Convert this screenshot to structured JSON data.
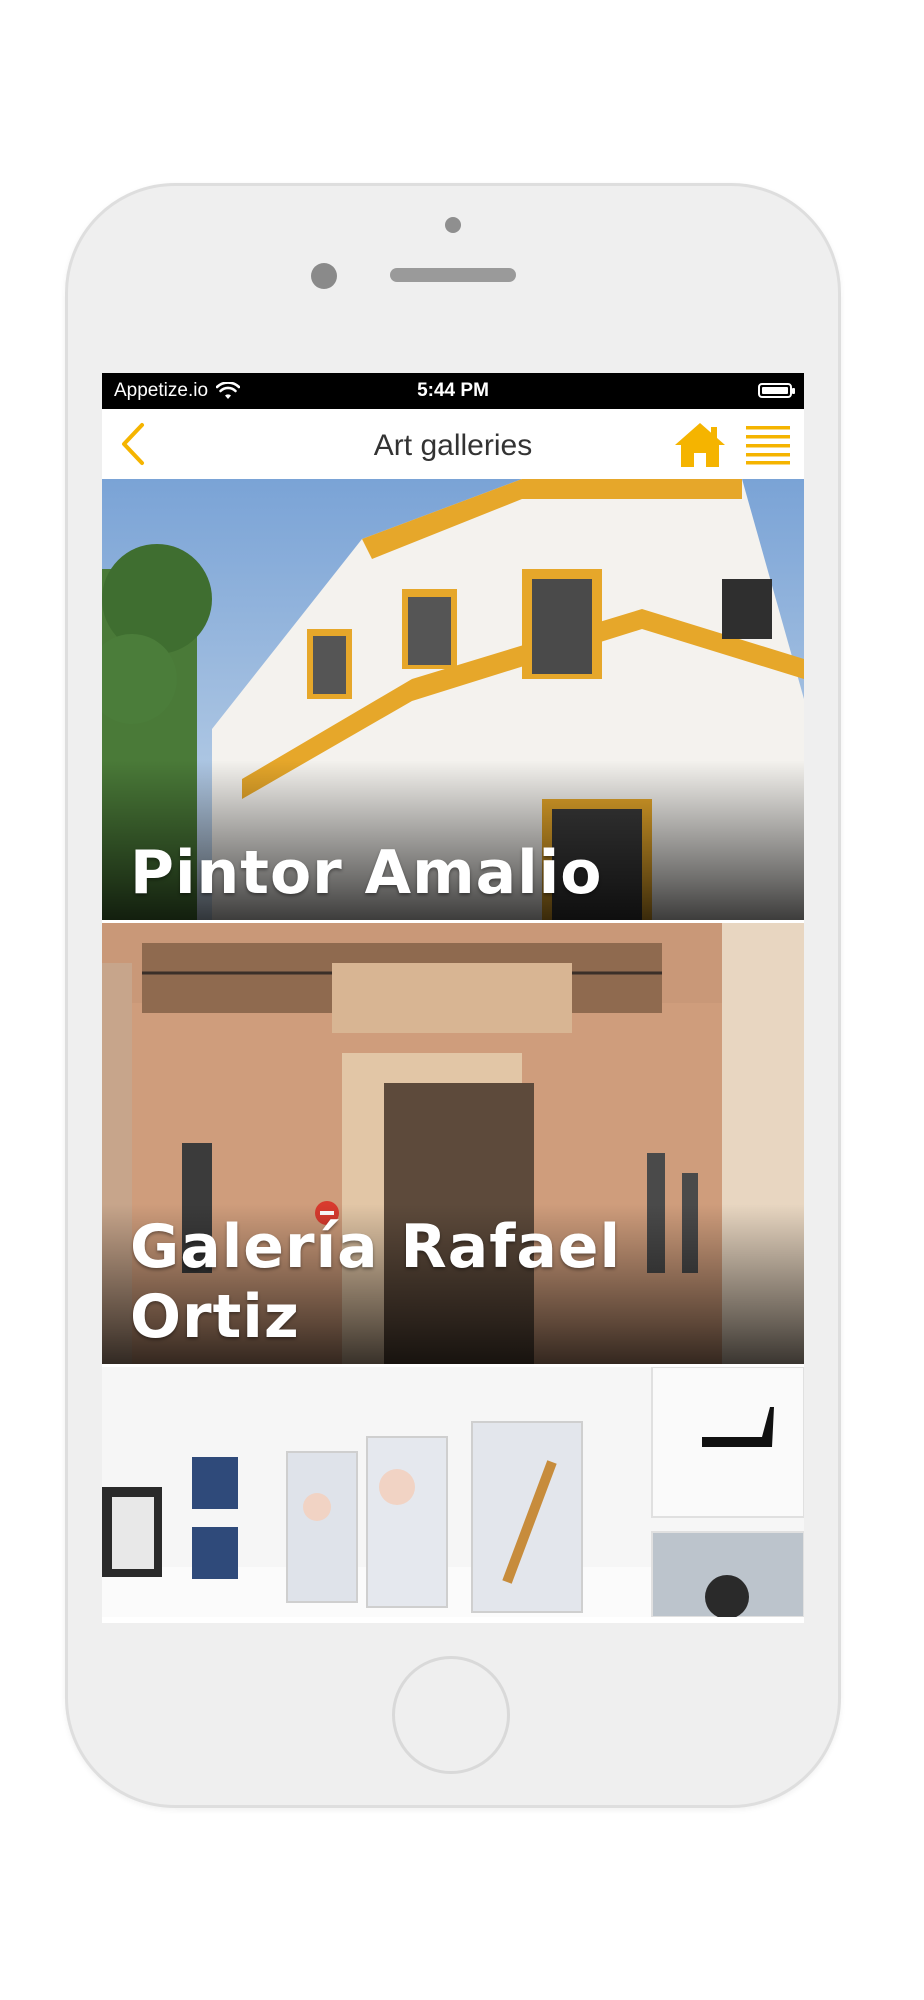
{
  "status_bar": {
    "carrier": "Appetize.io",
    "time": "5:44 PM"
  },
  "nav": {
    "title": "Art galleries",
    "back_icon": "chevron-left-icon",
    "home_icon": "home-icon",
    "menu_icon": "hamburger-menu-icon",
    "accent_color": "#F5B400"
  },
  "galleries": [
    {
      "name": "Pintor Amalio"
    },
    {
      "name": "Galería Rafael Ortiz"
    },
    {
      "name": ""
    }
  ]
}
